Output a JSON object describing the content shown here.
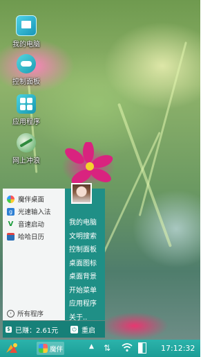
{
  "desktop": {
    "icons": [
      {
        "label": "我的电脑",
        "icon": "computer-icon"
      },
      {
        "label": "控制面板",
        "icon": "control-panel-icon"
      },
      {
        "label": "应用程序",
        "icon": "applications-icon"
      },
      {
        "label": "网上冲浪",
        "icon": "browser-icon"
      }
    ]
  },
  "start_menu": {
    "left_items": [
      {
        "label": "魔伴桌面",
        "icon": "pinwheel-icon"
      },
      {
        "label": "光速输入法",
        "icon": "input-method-icon"
      },
      {
        "label": "音速启动",
        "icon": "v-launcher-icon"
      },
      {
        "label": "哈哈日历",
        "icon": "calendar-icon"
      }
    ],
    "all_programs": "所有程序",
    "right_items": [
      "我的电脑",
      "文明搜索",
      "控制面板",
      "桌面图标",
      "桌面背景",
      "开始菜单",
      "应用程序",
      "关于.."
    ],
    "earned": "已赚：2.61元",
    "restart": "重启"
  },
  "taskbar": {
    "app_label": "魔伴",
    "clock": "17:12:32"
  },
  "colors": {
    "accent": "#1f8f86",
    "taskbar": "#24aaa2"
  }
}
